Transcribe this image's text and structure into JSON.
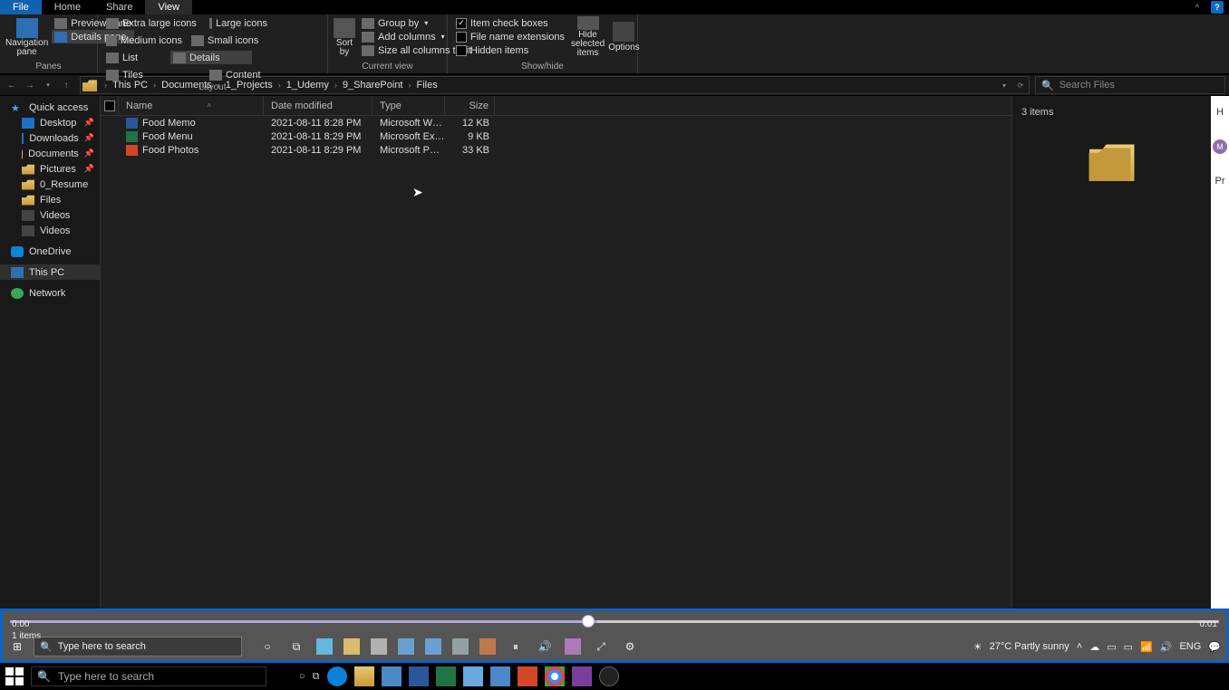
{
  "ribbon_tabs": {
    "file": "File",
    "home": "Home",
    "share": "Share",
    "view": "View"
  },
  "ribbon": {
    "panes": {
      "navigation": "Navigation pane",
      "preview": "Preview pane",
      "details": "Details pane",
      "group": "Panes"
    },
    "layout": {
      "extra_large": "Extra large icons",
      "large": "Large icons",
      "medium": "Medium icons",
      "small": "Small icons",
      "list": "List",
      "details": "Details",
      "tiles": "Tiles",
      "content": "Content",
      "group": "Layout"
    },
    "current_view": {
      "sort": "Sort by",
      "group_by": "Group by",
      "add_columns": "Add columns",
      "size_fit": "Size all columns to fit",
      "group": "Current view"
    },
    "show_hide": {
      "item_check": "Item check boxes",
      "file_ext": "File name extensions",
      "hidden": "Hidden items",
      "hide_selected": "Hide selected items",
      "options": "Options",
      "group": "Show/hide"
    }
  },
  "breadcrumb": [
    "This PC",
    "Documents",
    "1_Projects",
    "1_Udemy",
    "9_SharePoint",
    "Files"
  ],
  "search_placeholder": "Search Files",
  "nav": {
    "quick": "Quick access",
    "desktop": "Desktop",
    "downloads": "Downloads",
    "documents": "Documents",
    "pictures": "Pictures",
    "resume": "0_Resume",
    "files": "Files",
    "videos1": "Videos",
    "videos2": "Videos",
    "onedrive": "OneDrive",
    "thispc": "This PC",
    "network": "Network"
  },
  "columns": {
    "name": "Name",
    "date": "Date modified",
    "type": "Type",
    "size": "Size"
  },
  "files": [
    {
      "name": "Food Memo",
      "date": "2021-08-11 8:28 PM",
      "type": "Microsoft Word D...",
      "size": "12 KB",
      "icon": "doc"
    },
    {
      "name": "Food Menu",
      "date": "2021-08-11 8:29 PM",
      "type": "Microsoft Excel W...",
      "size": "9 KB",
      "icon": "xls"
    },
    {
      "name": "Food Photos",
      "date": "2021-08-11 8:29 PM",
      "type": "Microsoft PowerP...",
      "size": "33 KB",
      "icon": "ppt"
    }
  ],
  "details": {
    "count": "3 items"
  },
  "right_sliver": {
    "top": "H",
    "avatar": "M",
    "label": "Pr"
  },
  "video": {
    "items_text": "1 items",
    "time_left": "0:00",
    "time_right": "0:01",
    "search_placeholder": "Type here to search",
    "weather": "27°C  Partly sunny",
    "lang": "ENG"
  },
  "taskbar": {
    "search_placeholder": "Type here to search"
  }
}
